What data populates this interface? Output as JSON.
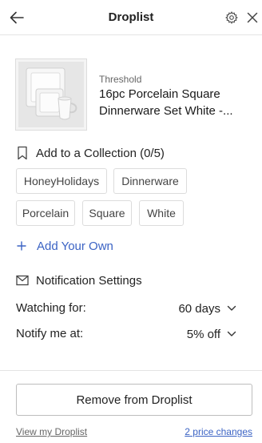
{
  "header": {
    "title": "Droplist",
    "back_icon": "arrow-left-icon",
    "settings_icon": "gear-icon",
    "close_icon": "close-icon"
  },
  "product": {
    "brand": "Threshold",
    "name": "16pc Porcelain Square Dinnerware Set White -..."
  },
  "collection": {
    "label": "Add to a Collection (0/5)",
    "icon": "bookmark-icon",
    "tags": [
      "HoneyHolidays",
      "Dinnerware",
      "Porcelain",
      "Square",
      "White"
    ]
  },
  "add_own": {
    "label": "Add Your Own",
    "icon": "plus-icon"
  },
  "notifications": {
    "label": "Notification Settings",
    "icon": "envelope-icon",
    "watching_label": "Watching for:",
    "watching_value": "60 days",
    "notify_label": "Notify me at:",
    "notify_value": "5% off"
  },
  "footer": {
    "remove_label": "Remove from Droplist",
    "view_link": "View my Droplist",
    "price_changes": "2 price changes"
  },
  "colors": {
    "accent": "#3b63c4",
    "border": "#dcdcdc",
    "text": "#222222"
  }
}
